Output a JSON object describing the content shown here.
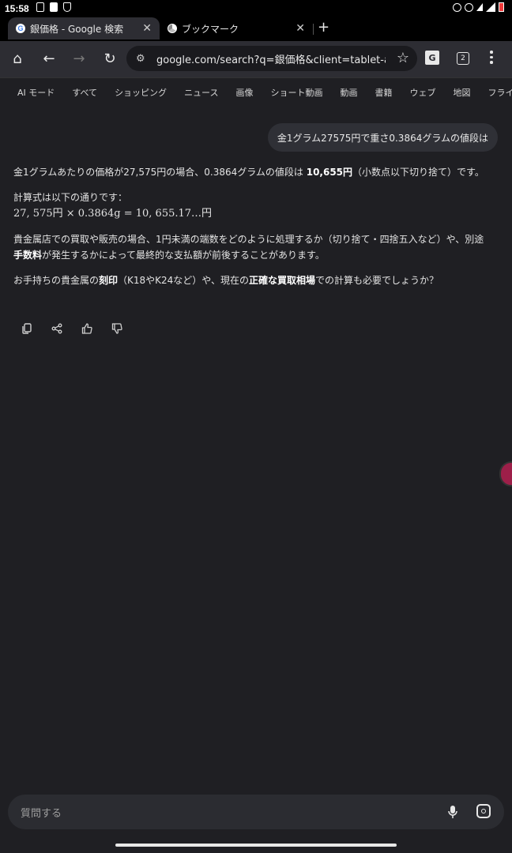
{
  "status": {
    "time": "15:58",
    "icons": [
      "notification-icon",
      "battery-saver-icon",
      "shield-icon"
    ],
    "right_icons": [
      "alarm-icon",
      "vibrate-icon",
      "wifi-icon",
      "signal-icon",
      "battery-low-icon"
    ]
  },
  "tabs": [
    {
      "label": "銀価格 - Google 検索",
      "favicon": "google-icon",
      "active": true
    },
    {
      "label": "ブックマーク",
      "favicon": "chrome-icon",
      "active": false
    }
  ],
  "toolbar": {
    "url": "google.com/search?q=銀価格&client=tablet-andi",
    "tab_count": "2"
  },
  "chips": [
    "AI モード",
    "すべて",
    "ショッピング",
    "ニュース",
    "画像",
    "ショート動画",
    "動画",
    "書籍",
    "ウェブ",
    "地図",
    "フライト"
  ],
  "query": "金1グラム27575円で重さ0.3864グラムの値段は",
  "answer": {
    "p1_pre": "金1グラムあたりの価格が27,575円の場合、0.3864グラムの値段は ",
    "p1_bold": "10,655円",
    "p1_post": "（小数点以下切り捨て）です。",
    "p2_label": "計算式は以下の通りです：",
    "formula": "27, 575円 × 0.3864g = 10, 655.17…円",
    "p3_a": "貴金属店での買取や販売の場合、1円未満の端数をどのように処理するか（切り捨て・四捨五入など）や、別途",
    "p3_bold": "手数料",
    "p3_b": "が発生するかによって最終的な支払額が前後することがあります。",
    "p4_a": "お手持ちの貴金属の",
    "p4_bold1": "刻印",
    "p4_b": "（K18やK24など）や、現在の",
    "p4_bold2": "正確な買取相場",
    "p4_c": "での計算も必要でしょうか？"
  },
  "ask": {
    "placeholder": "質問する"
  },
  "colors": {
    "background": "#1f1f23",
    "toolbar": "#2d2d33",
    "fab": "#9d1f49"
  }
}
